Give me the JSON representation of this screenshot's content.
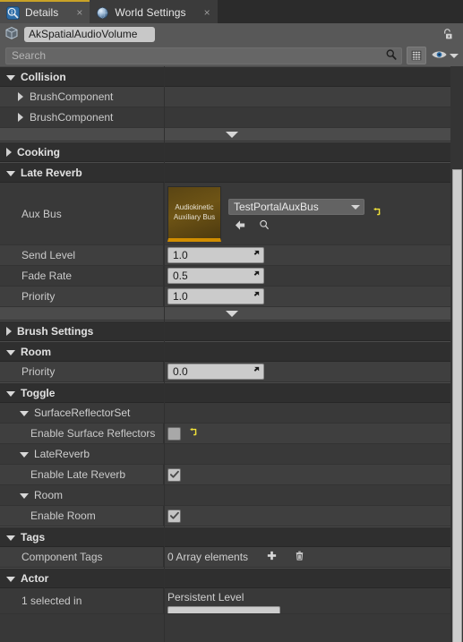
{
  "tabs": [
    {
      "label": "Details",
      "icon": "details-magnifier-icon",
      "active": true,
      "close": "×"
    },
    {
      "label": "World Settings",
      "icon": "globe-icon",
      "active": false,
      "close": "×"
    }
  ],
  "actor": {
    "icon": "volume-box-icon",
    "name": "AkSpatialAudioVolume",
    "lock_icon": "unlock-icon"
  },
  "search": {
    "placeholder": "Search",
    "search_icon": "search-icon",
    "grid_icon": "grid-view-icon",
    "eye_icon": "eye-icon",
    "eye_caret_icon": "chevron-down-icon"
  },
  "categories": {
    "collision": {
      "label": "Collision",
      "components": [
        "BrushComponent",
        "BrushComponent"
      ]
    },
    "cooking": {
      "label": "Cooking"
    },
    "late_reverb": {
      "label": "Late Reverb",
      "aux_bus": {
        "label": "Aux Bus",
        "thumb_line1": "Audiokinetic",
        "thumb_line2": "Auxiliary Bus",
        "value": "TestPortalAuxBus",
        "back_icon": "arrow-left-icon",
        "browse_icon": "browse-magnifier-icon",
        "reset_icon": "reset-to-default-icon"
      },
      "fields": [
        {
          "label": "Send Level",
          "value": "1.0"
        },
        {
          "label": "Fade Rate",
          "value": "0.5"
        },
        {
          "label": "Priority",
          "value": "1.0"
        }
      ]
    },
    "brush_settings": {
      "label": "Brush Settings"
    },
    "room": {
      "label": "Room",
      "fields": [
        {
          "label": "Priority",
          "value": "0.0"
        }
      ]
    },
    "toggle": {
      "label": "Toggle",
      "groups": [
        {
          "label": "SurfaceReflectorSet",
          "rows": [
            {
              "label": "Enable Surface Reflectors",
              "checked": false,
              "reset_icon": "reset-to-default-icon"
            }
          ]
        },
        {
          "label": "LateReverb",
          "rows": [
            {
              "label": "Enable Late Reverb",
              "checked": true,
              "reset_icon": ""
            }
          ]
        },
        {
          "label": "Room",
          "rows": [
            {
              "label": "Enable Room",
              "checked": true,
              "reset_icon": ""
            }
          ]
        }
      ]
    },
    "tags": {
      "label": "Tags",
      "row": {
        "label": "Component Tags",
        "value": "0 Array elements",
        "add_icon": "plus-icon",
        "delete_icon": "trash-icon"
      }
    },
    "actor_cat": {
      "label": "Actor",
      "row": {
        "label": "1 selected in",
        "value": "Persistent Level"
      }
    }
  },
  "colors": {
    "accent": "#c9a227",
    "reset_yellow": "#f2e33a",
    "thumb_bar": "#d18e00",
    "panel_bg": "#383838"
  }
}
